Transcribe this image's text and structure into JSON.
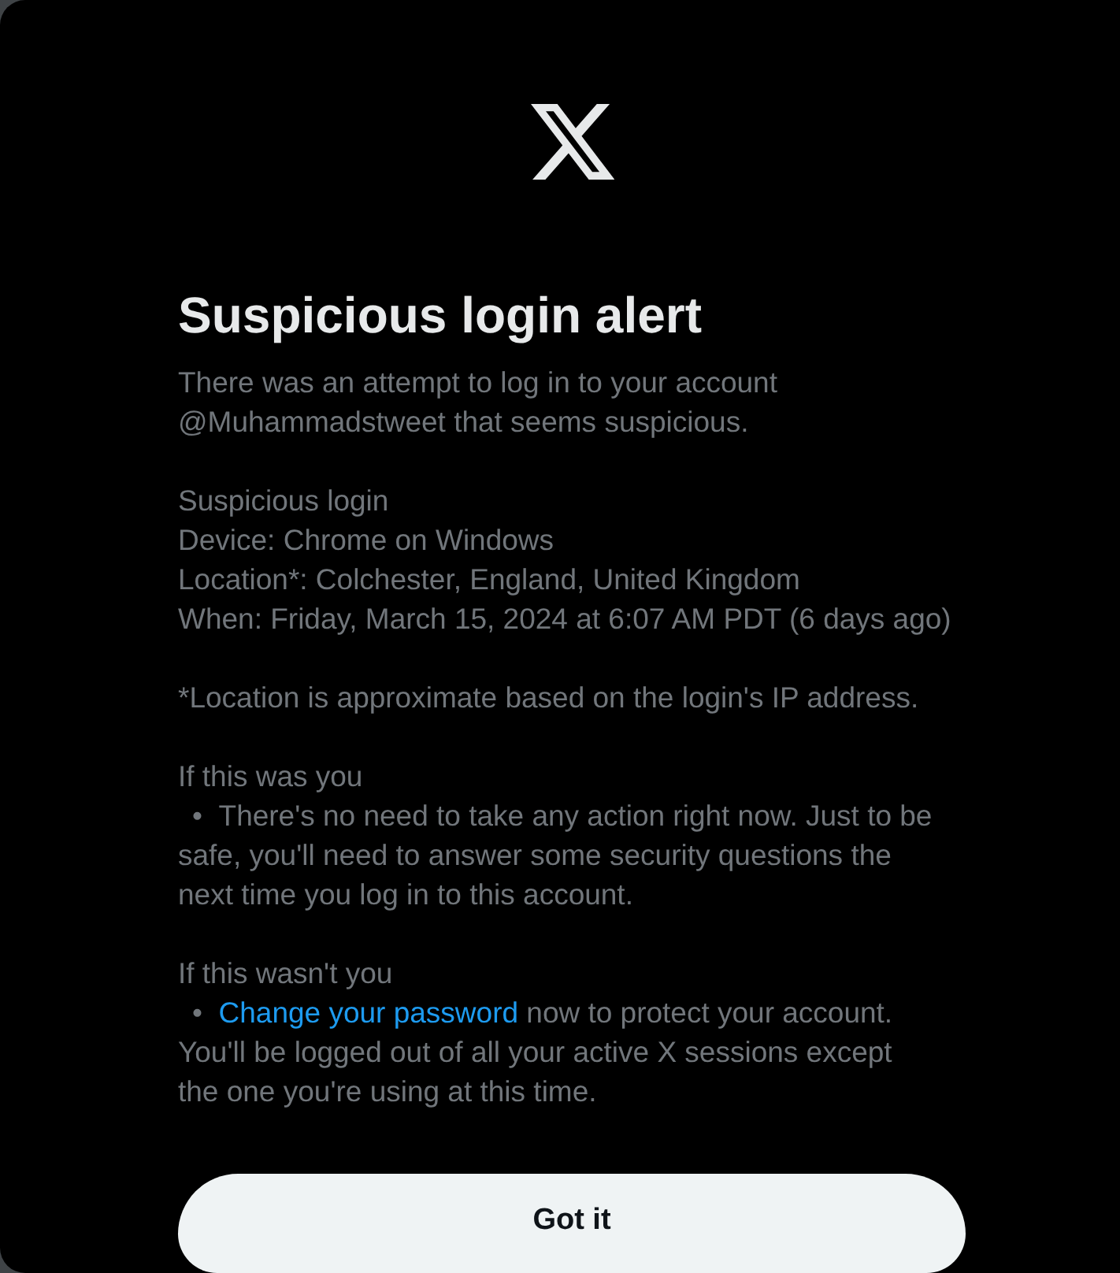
{
  "title": "Suspicious login alert",
  "intro": "There was an attempt to log in to your account @Muhammadstweet that seems suspicious.",
  "details": {
    "heading": "Suspicious login",
    "lines": [
      "Device: Chrome on Windows",
      "Location*: Colchester, England, United Kingdom",
      "When: Friday, March 15, 2024 at 6:07 AM PDT (6 days ago)"
    ]
  },
  "note": "*Location is approximate based on the login's IP address.",
  "sections": [
    {
      "heading": "If this was you",
      "bullet": {
        "marker": "•",
        "text": "There's no need to take any action right now. Just to be safe, you'll need to answer some security questions the next time you log in to this account."
      }
    },
    {
      "heading": "If this wasn't you",
      "bullet": {
        "marker": "•",
        "link": "Change your password",
        "text": "now to protect your account. You'll be logged out of all your active X sessions except the one you're using at this time."
      }
    }
  ],
  "button": "Got it"
}
